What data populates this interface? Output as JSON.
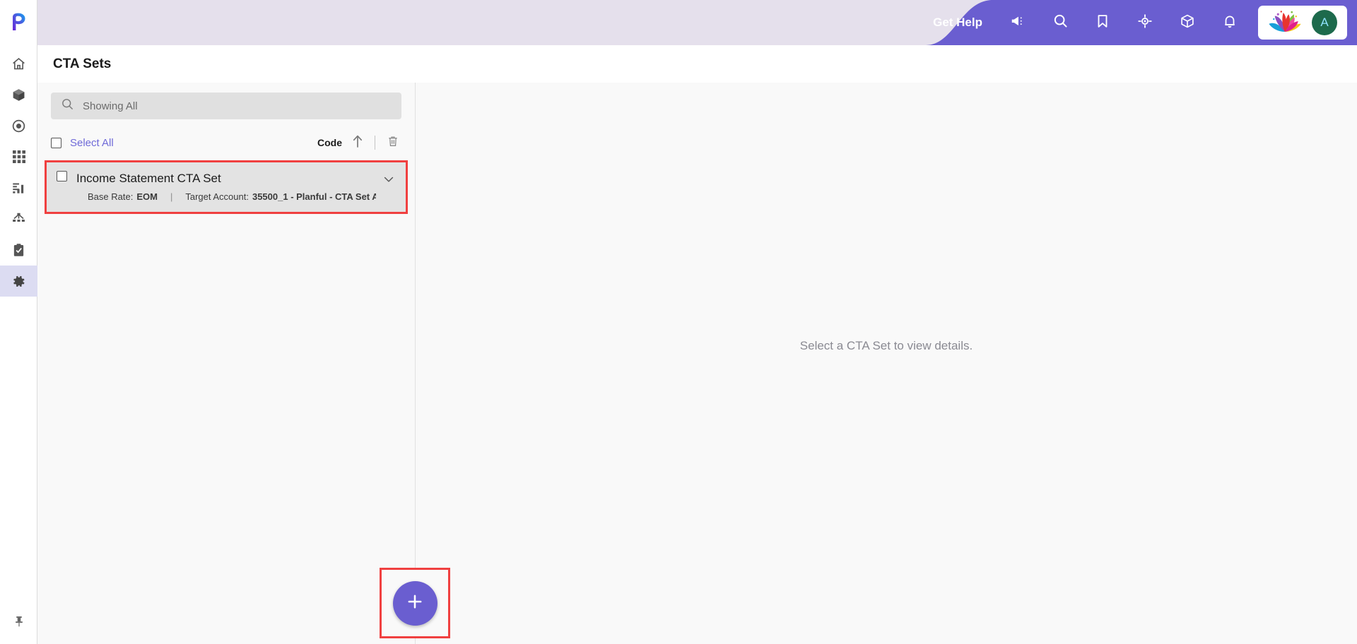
{
  "topbar": {
    "get_help_label": "Get Help",
    "icons": [
      {
        "name": "announcement-icon"
      },
      {
        "name": "search-icon"
      },
      {
        "name": "bookmark-icon"
      },
      {
        "name": "target-icon"
      },
      {
        "name": "cube-icon"
      },
      {
        "name": "bell-icon"
      }
    ],
    "brand_logo_name": "lotus-logo",
    "avatar_initial": "A",
    "purple_hex": "#6A5ED0",
    "bar_hex": "#E5E0EC",
    "avatar_hex": "#1D6A4C"
  },
  "rail": {
    "logo_name": "planful-logo",
    "items": [
      {
        "name": "sidebar-item-home",
        "icon": "home-icon",
        "active": false
      },
      {
        "name": "sidebar-item-cube",
        "icon": "cube-icon",
        "active": false
      },
      {
        "name": "sidebar-item-target",
        "icon": "target-icon",
        "active": false
      },
      {
        "name": "sidebar-item-grid",
        "icon": "grid-icon",
        "active": false
      },
      {
        "name": "sidebar-item-reports",
        "icon": "bar-chart-icon",
        "active": false
      },
      {
        "name": "sidebar-item-hierarchy",
        "icon": "hierarchy-icon",
        "active": false
      },
      {
        "name": "sidebar-item-tasks",
        "icon": "clipboard-check-icon",
        "active": false
      },
      {
        "name": "sidebar-item-settings",
        "icon": "gear-icon",
        "active": true
      }
    ],
    "pin_name": "pin-icon",
    "active_hex": "#DCDCF2"
  },
  "page": {
    "title": "CTA Sets"
  },
  "search": {
    "value": "Showing All",
    "placeholder": "Showing All",
    "icon": "search-icon"
  },
  "toolbar": {
    "select_all_label": "Select All",
    "sort_label": "Code",
    "sort_direction_icon": "arrow-up-icon",
    "delete_icon": "trash-icon"
  },
  "list": {
    "items": [
      {
        "title": "Income Statement CTA Set",
        "base_rate_label": "Base Rate:",
        "base_rate_value": "EOM",
        "separator": "|",
        "target_account_label": "Target Account:",
        "target_account_value": "35500_1 - Planful - CTA Set A...",
        "expand_icon": "chevron-down-icon",
        "highlighted": true
      }
    ]
  },
  "fab": {
    "label": "+",
    "name": "add-cta-set-button",
    "highlighted": true,
    "color": "#6A5ED0"
  },
  "detail": {
    "empty_message": "Select a CTA Set to view details."
  },
  "highlight": {
    "color": "#F04040"
  }
}
